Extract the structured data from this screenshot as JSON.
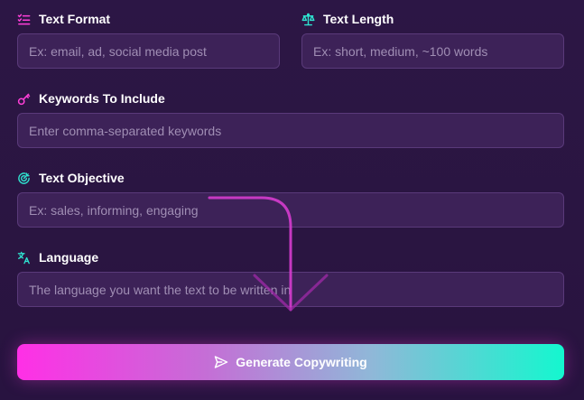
{
  "form": {
    "text_format": {
      "label": "Text Format",
      "icon": "checklist-icon",
      "placeholder": "Ex: email, ad, social media post",
      "value": ""
    },
    "text_length": {
      "label": "Text Length",
      "icon": "scale-icon",
      "placeholder": "Ex: short, medium, ~100 words",
      "value": ""
    },
    "keywords": {
      "label": "Keywords To Include",
      "icon": "key-icon",
      "placeholder": "Enter comma-separated keywords",
      "value": ""
    },
    "objective": {
      "label": "Text Objective",
      "icon": "target-icon",
      "placeholder": "Ex: sales, informing, engaging",
      "value": ""
    },
    "language": {
      "label": "Language",
      "icon": "translate-icon",
      "placeholder": "The language you want the text to be written in",
      "value": ""
    }
  },
  "generate_button": {
    "label": "Generate Copywriting",
    "icon": "send-icon"
  },
  "colors": {
    "background": "#2c1645",
    "field_bg": "#3d2258",
    "field_border": "#5a3a7a",
    "accent_pink": "#ff2fe6",
    "accent_teal": "#14f7cf"
  }
}
